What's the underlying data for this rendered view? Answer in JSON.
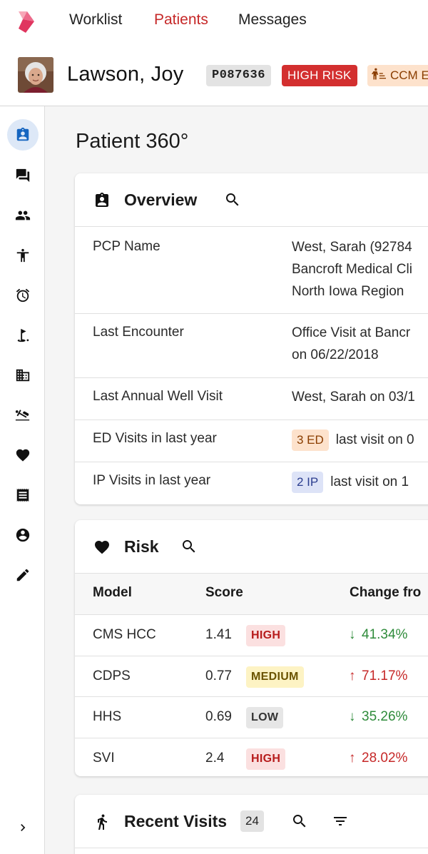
{
  "nav": {
    "links": [
      {
        "label": "Worklist",
        "active": false
      },
      {
        "label": "Patients",
        "active": true
      },
      {
        "label": "Messages",
        "active": false
      }
    ]
  },
  "patient": {
    "name": "Lawson, Joy",
    "id": "P087636",
    "risk_chip": "HIGH RISK",
    "program_chip": "CCM E"
  },
  "sidebar": {
    "items": [
      {
        "icon": "patient-card-icon",
        "active": true
      },
      {
        "icon": "chat-icon",
        "active": false
      },
      {
        "icon": "people-icon",
        "active": false
      },
      {
        "icon": "accessibility-icon",
        "active": false
      },
      {
        "icon": "alarm-icon",
        "active": false
      },
      {
        "icon": "golf-icon",
        "active": false
      },
      {
        "icon": "building-icon",
        "active": false
      },
      {
        "icon": "hotel-bed-icon",
        "active": false
      },
      {
        "icon": "heart-icon",
        "active": false
      },
      {
        "icon": "receipt-icon",
        "active": false
      },
      {
        "icon": "account-circle-icon",
        "active": false
      },
      {
        "icon": "pencil-icon",
        "active": false
      }
    ]
  },
  "page": {
    "title": "Patient 360°"
  },
  "overview": {
    "title": "Overview",
    "rows": [
      {
        "label": "PCP Name",
        "lines": [
          "West, Sarah (92784",
          "Bancroft Medical Cli",
          "North Iowa Region"
        ]
      },
      {
        "label": "Last Encounter",
        "lines": [
          "Office Visit at Bancr",
          "on 06/22/2018"
        ]
      },
      {
        "label": "Last Annual Well Visit",
        "lines": [
          "West, Sarah on 03/1"
        ]
      },
      {
        "label": "ED Visits in last year",
        "badge": "3 ED",
        "text": "last visit on 0"
      },
      {
        "label": "IP Visits in last year",
        "badge": "2 IP",
        "text": "last visit on 1"
      }
    ]
  },
  "risk": {
    "title": "Risk",
    "headers": {
      "model": "Model",
      "score": "Score",
      "change": "Change fro"
    },
    "rows": [
      {
        "model": "CMS HCC",
        "score": "1.41",
        "level": "HIGH",
        "change": "41.34%",
        "direction": "down"
      },
      {
        "model": "CDPS",
        "score": "0.77",
        "level": "MEDIUM",
        "change": "71.17%",
        "direction": "up"
      },
      {
        "model": "HHS",
        "score": "0.69",
        "level": "LOW",
        "change": "35.26%",
        "direction": "down"
      },
      {
        "model": "SVI",
        "score": "2.4",
        "level": "HIGH",
        "change": "28.02%",
        "direction": "up"
      }
    ]
  },
  "recent_visits": {
    "title": "Recent Visits",
    "count": "24"
  },
  "colors": {
    "accent_red": "#c62828",
    "high_risk": "#d32f2f",
    "positive_green": "#2e8b3a",
    "sidebar_active": "#dde8f7"
  }
}
